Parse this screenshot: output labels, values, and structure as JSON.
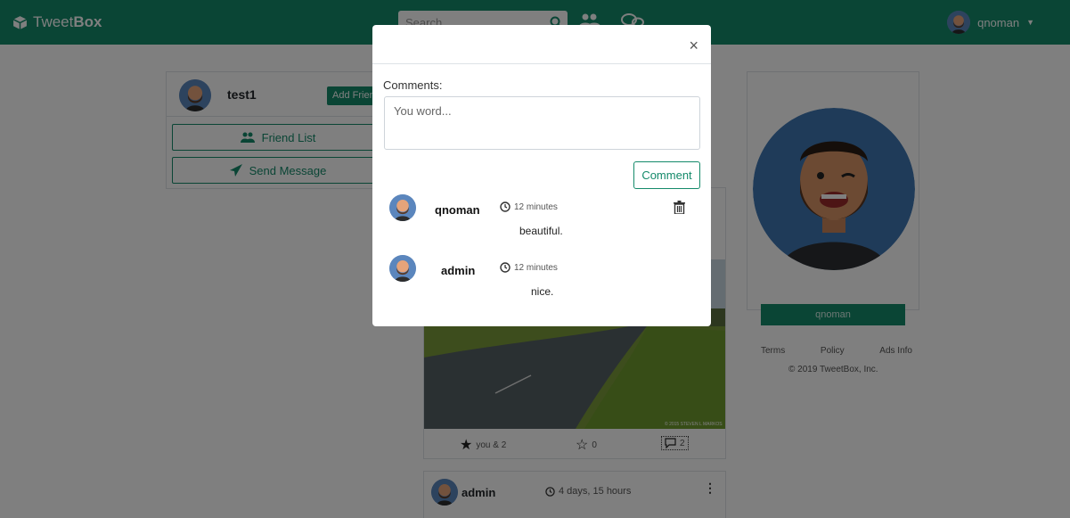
{
  "navbar": {
    "brand_prefix": "Tweet",
    "brand_bold": "Box",
    "search_placeholder": "Search",
    "user_name": "qnoman",
    "brand_color": "#148a6a"
  },
  "left_card": {
    "name": "test1",
    "add_friend": "Add Friend",
    "friend_list": "Friend List",
    "send_message": "Send Message"
  },
  "post": {
    "likes": "you & 2",
    "stars": "0",
    "comments": "2",
    "image_credit": "© 2015 STEVEN L MARKOS"
  },
  "post2": {
    "author": "admin",
    "time": "4 days, 15 hours"
  },
  "right_card": {
    "name": "qnoman"
  },
  "footer": {
    "terms": "Terms",
    "policy": "Policy",
    "ads": "Ads Info",
    "copyright": "© 2019 TweetBox, Inc."
  },
  "modal": {
    "close": "×",
    "label": "Comments:",
    "placeholder": "You word...",
    "submit": "Comment",
    "comments": [
      {
        "user": "qnoman",
        "time": "12 minutes",
        "text": "beautiful."
      },
      {
        "user": "admin",
        "time": "12 minutes",
        "text": "nice."
      }
    ]
  }
}
